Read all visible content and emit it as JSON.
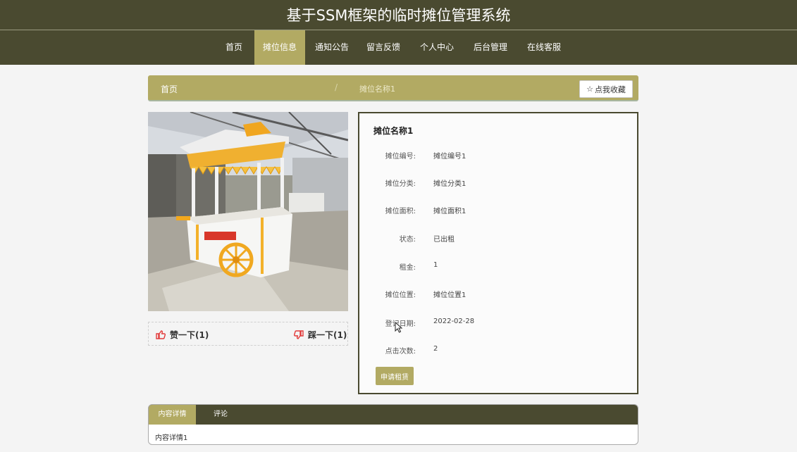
{
  "header": {
    "title": "基于SSM框架的临时摊位管理系统"
  },
  "nav": [
    {
      "label": "首页",
      "active": false
    },
    {
      "label": "摊位信息",
      "active": true
    },
    {
      "label": "通知公告",
      "active": false
    },
    {
      "label": "留言反馈",
      "active": false
    },
    {
      "label": "个人中心",
      "active": false
    },
    {
      "label": "后台管理",
      "active": false
    },
    {
      "label": "在线客服",
      "active": false
    }
  ],
  "breadcrumb": {
    "home": "首页",
    "separator": "/",
    "current": "摊位名称1"
  },
  "favorite_button": {
    "icon": "star-outline-icon",
    "label": "点我收藏"
  },
  "photo": {
    "description_icon": "food-cart-photo"
  },
  "votes": {
    "like": {
      "icon": "thumbs-up-icon",
      "label": "赞一下(1)"
    },
    "dislike": {
      "icon": "thumbs-down-icon",
      "label": "踩一下(1)"
    }
  },
  "detail": {
    "title": "摊位名称1",
    "fields": [
      {
        "label": "摊位编号:",
        "value": "摊位编号1"
      },
      {
        "label": "摊位分类:",
        "value": "摊位分类1"
      },
      {
        "label": "摊位面积:",
        "value": "摊位面积1"
      },
      {
        "label": "状态:",
        "value": "已出租"
      },
      {
        "label": "租金:",
        "value": "1"
      },
      {
        "label": "摊位位置:",
        "value": "摊位位置1"
      },
      {
        "label": "登记日期:",
        "value": "2022-02-28"
      },
      {
        "label": "点击次数:",
        "value": "2"
      }
    ],
    "rent_button": "申请租赁"
  },
  "tabs": [
    {
      "label": "内容详情",
      "active": true
    },
    {
      "label": "评论",
      "active": false
    }
  ],
  "tab_content": "内容详情1",
  "colors": {
    "header_bg": "#4a4a30",
    "accent": "#b2aa63",
    "page_bg": "#f4f4f4",
    "like_red": "#e23a3a"
  }
}
